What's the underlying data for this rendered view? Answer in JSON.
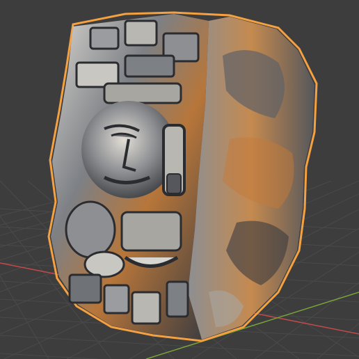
{
  "viewport": {
    "background_color": "#3d3d3d",
    "grid_color": "#4a4a4a",
    "x_axis_color": "#c24a4a",
    "y_axis_color": "#7aa23a",
    "selection_outline_color": "#f5a142"
  },
  "object": {
    "description_icon": "carved-stone-sculpture-model",
    "selected": true,
    "stone_base_color": "#6f7378",
    "stone_highlight_color": "#c9c7c2",
    "stone_shadow_color": "#2b2c30",
    "stone_accent_color": "#c47a3a"
  }
}
